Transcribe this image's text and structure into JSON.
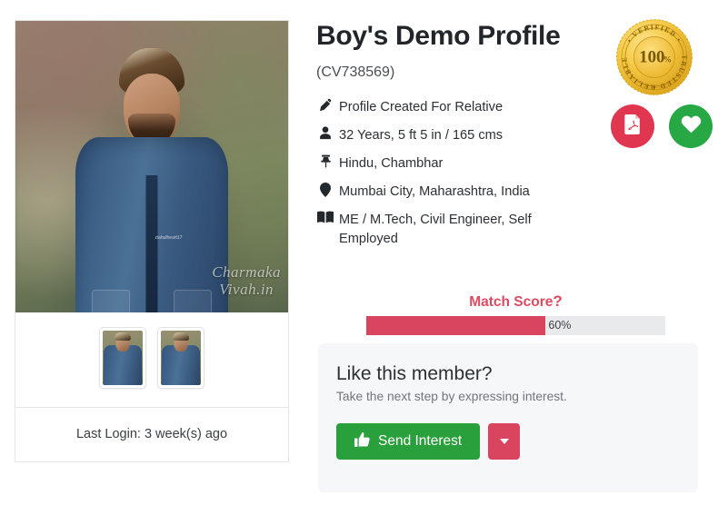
{
  "profile": {
    "name": "Boy's Demo Profile",
    "cv_id": "(CV738569)",
    "photo_watermark_line1": "Charmaka",
    "photo_watermark_line2": "Vivah.in",
    "photo_tiny_watermark": "ziahulheart17",
    "last_login": "Last Login: 3 week(s) ago",
    "details": [
      {
        "icon": "pen-icon",
        "text": "Profile Created For Relative"
      },
      {
        "icon": "person-icon",
        "text": "32 Years, 5 ft 5 in / 165 cms"
      },
      {
        "icon": "pushpin-icon",
        "text": "Hindu, Chambhar"
      },
      {
        "icon": "map-marker-icon",
        "text": "Mumbai City, Maharashtra, India"
      },
      {
        "icon": "book-icon",
        "text": "ME / M.Tech, Civil Engineer, Self Employed"
      }
    ]
  },
  "badge": {
    "name": "verified-seal",
    "center_value": "100",
    "center_unit": "%",
    "ring_text_top": "VERIFIED",
    "ring_text_right": "TRUSTED",
    "ring_text_bottom": "RELIABLE",
    "color_outer": "#f0c040",
    "color_inner": "#f5cf5a"
  },
  "actions": {
    "pdf_label": "pdf-download",
    "favourite_label": "add-to-favourites",
    "pdf_color": "#e0364f",
    "favourite_color": "#28a745"
  },
  "match_score": {
    "label": "Match Score",
    "help_glyph": "?",
    "value": 60,
    "value_text": "60%",
    "fill_color": "#d9455f",
    "track_color": "#e9eaec",
    "label_color": "#dd4b61"
  },
  "like_panel": {
    "title": "Like this member?",
    "subtitle": "Take the next step by expressing interest.",
    "send_label": "Send Interest",
    "send_color": "#2aa03c",
    "dropdown_color": "#d9455f"
  },
  "thumbnails": [
    {
      "name": "thumbnail-1"
    },
    {
      "name": "thumbnail-2"
    }
  ]
}
